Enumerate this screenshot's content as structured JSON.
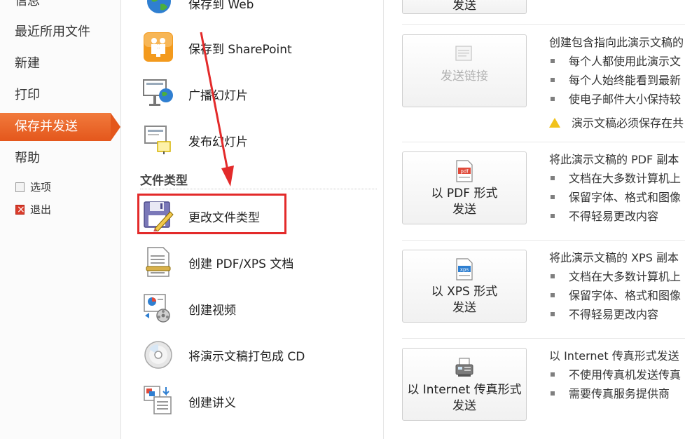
{
  "nav": {
    "items": [
      {
        "label": "信息"
      },
      {
        "label": "最近所用文件"
      },
      {
        "label": "新建"
      },
      {
        "label": "打印"
      },
      {
        "label": "保存并发送"
      },
      {
        "label": "帮助"
      }
    ],
    "options_label": "选项",
    "exit_label": "退出",
    "active": "保存并发送"
  },
  "middle": {
    "top_items": [
      {
        "label": "保存到 Web"
      },
      {
        "label": "保存到 SharePoint"
      },
      {
        "label": "广播幻灯片"
      },
      {
        "label": "发布幻灯片"
      }
    ],
    "section_title": "文件类型",
    "file_items": [
      {
        "label": "更改文件类型"
      },
      {
        "label": "创建 PDF/XPS 文档"
      },
      {
        "label": "创建视频"
      },
      {
        "label": "将演示文稿打包成 CD"
      },
      {
        "label": "创建讲义"
      }
    ]
  },
  "right": {
    "top_button_label": "发送",
    "link": {
      "button": "发送链接",
      "desc": "创建包含指向此演示文稿的",
      "bullets": [
        "每个人都使用此演示文",
        "每个人始终能看到最新",
        "使电子邮件大小保持较"
      ],
      "warning": "演示文稿必须保存在共"
    },
    "pdf": {
      "button_line1": "以 PDF 形式",
      "button_line2": "发送",
      "desc": "将此演示文稿的 PDF 副本",
      "bullets": [
        "文档在大多数计算机上",
        "保留字体、格式和图像",
        "不得轻易更改内容"
      ]
    },
    "xps": {
      "button_line1": "以 XPS 形式",
      "button_line2": "发送",
      "desc": "将此演示文稿的 XPS 副本",
      "bullets": [
        "文档在大多数计算机上",
        "保留字体、格式和图像",
        "不得轻易更改内容"
      ]
    },
    "fax": {
      "button_line1": "以 Internet 传真形式",
      "button_line2": "发送",
      "desc": "以 Internet 传真形式发送",
      "bullets": [
        "不使用传真机发送传真",
        "需要传真服务提供商"
      ]
    }
  },
  "colors": {
    "nav_active": "#e4571c",
    "highlight_border": "#e32a2a",
    "arrow": "#e32a2a"
  }
}
